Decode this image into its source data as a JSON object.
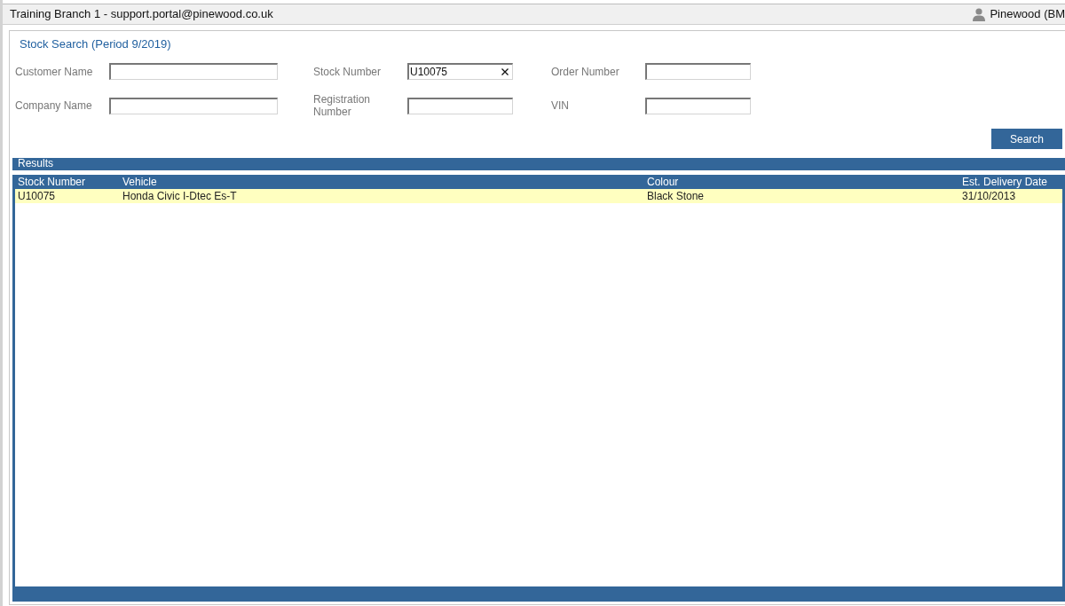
{
  "header": {
    "title": "Training Branch 1 - support.portal@pinewood.co.uk",
    "user": "Pinewood (BM"
  },
  "search_panel": {
    "title": "Stock Search (Period 9/2019)",
    "fields": [
      {
        "label": "Customer Name"
      },
      {
        "label": "Stock Number",
        "value": "U10075"
      },
      {
        "label": "Order Number"
      },
      {
        "label": "Company Name"
      },
      {
        "label": "Registration Number"
      },
      {
        "label": "VIN"
      }
    ],
    "search_button": "Search"
  },
  "results": {
    "title": "Results",
    "columns": [
      "Stock Number",
      "Vehicle",
      "Colour",
      "Est. Delivery Date"
    ],
    "rows": [
      {
        "selected": true,
        "cells": [
          "U10075",
          "Honda Civic I-Dtec Es-T",
          "Black Stone",
          "31/10/2013"
        ]
      }
    ]
  }
}
